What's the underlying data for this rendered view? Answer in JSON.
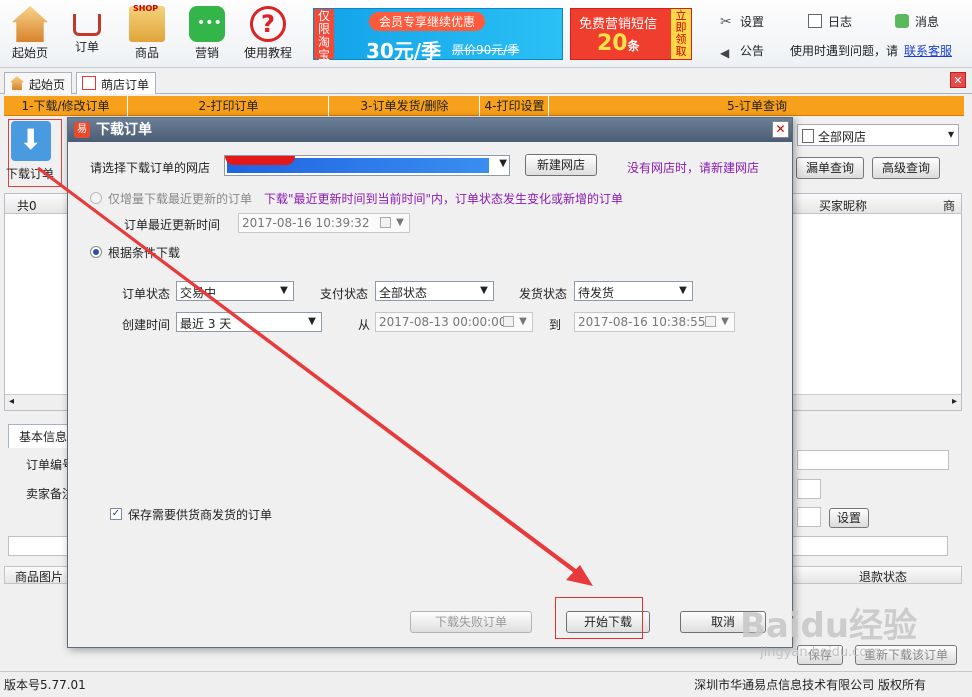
{
  "toolbar": {
    "home": "起始页",
    "orders": "订单",
    "goods": "商品",
    "marketing": "营销",
    "tutorial": "使用教程",
    "settings": "设置",
    "log": "日志",
    "messages": "消息",
    "announcement": "公告",
    "help_text": "使用时遇到问题，请",
    "contact": "联系客服"
  },
  "ads": {
    "vip_tag": "仅限淘宝",
    "vip_title": "会员专享继续优惠",
    "vip_price": "30元/季",
    "vip_original": "原价90元/季",
    "sms_title": "免费营销短信",
    "sms_count": "20",
    "sms_unit": "条",
    "sms_tag": "立即领取"
  },
  "tabs": {
    "home": "起始页",
    "shop_orders": "萌店订单"
  },
  "steps": [
    "1-下载/修改订单",
    "2-打印订单",
    "3-订单发货/删除",
    "4-打印设置",
    "5-订单查询"
  ],
  "main": {
    "download_order": "下载订单",
    "store_filter": "全部网店",
    "missed_query": "漏单查询",
    "advanced_query": "高级查询",
    "total": "共0",
    "col_buyer_nick": "买家昵称",
    "col_more": "商",
    "basic_info_tab": "基本信息",
    "order_no_label": "订单编号",
    "seller_note_label": "卖家备注",
    "set_button": "设置",
    "goods_image": "商品图片",
    "refund_status": "退款状态",
    "save_button": "保存",
    "redownload_button": "重新下载该订单"
  },
  "dialog": {
    "title": "下载订单",
    "logo_glyph": "易",
    "choose_store_label": "请选择下载订单的网店",
    "new_store_button": "新建网店",
    "no_store_hint": "没有网店时，请新建网店",
    "incremental_option": "仅增量下载最近更新的订单",
    "incremental_desc": "下载\"最近更新时间到当前时间\"内，订单状态发生变化或新增的订单",
    "last_update_label": "订单最近更新时间",
    "last_update_value": "2017-08-16 10:39:32",
    "conditional_option": "根据条件下载",
    "order_status_label": "订单状态",
    "order_status_value": "交易中",
    "pay_status_label": "支付状态",
    "pay_status_value": "全部状态",
    "ship_status_label": "发货状态",
    "ship_status_value": "待发货",
    "create_time_label": "创建时间",
    "create_time_value": "最近 3 天",
    "from_label": "从",
    "from_value": "2017-08-13 00:00:00",
    "to_label": "到",
    "to_value": "2017-08-16 10:38:55",
    "save_supplier_checkbox": "保存需要供货商发货的订单",
    "download_failed_button": "下载失败订单",
    "start_download_button": "开始下载",
    "cancel_button": "取消"
  },
  "status": {
    "version": "版本号5.77.01",
    "company": "深圳市华通易点信息技术有限公司 版权所有"
  },
  "watermark": {
    "brand": "Baidu经验",
    "url": "jingyan.baidu.com"
  },
  "colors": {
    "step_bar": "#f7a01c",
    "annotation_red": "#e83a3a",
    "hint_purple": "#8a1bb0",
    "selection_blue": "#1f64e0"
  }
}
